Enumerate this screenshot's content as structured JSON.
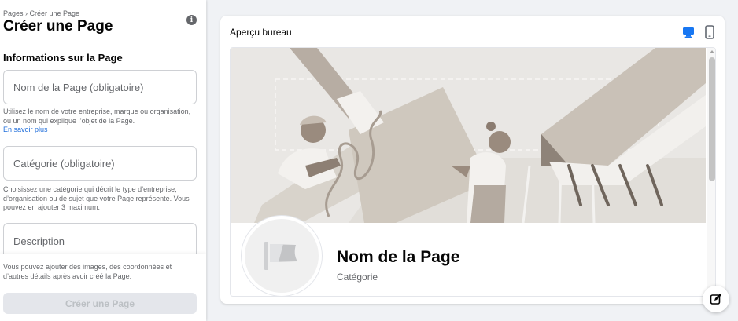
{
  "breadcrumb": "Pages › Créer une Page",
  "title": "Créer une Page",
  "info_icon": "i",
  "form": {
    "section_heading": "Informations sur la Page",
    "name_placeholder": "Nom de la Page (obligatoire)",
    "name_helper": "Utilisez le nom de votre entreprise, marque ou organisation, ou un nom qui explique l’objet de la Page.",
    "learn_more": "En savoir plus",
    "category_placeholder": "Catégorie (obligatoire)",
    "category_helper": "Choisissez une catégorie qui décrit le type d’entreprise, d’organisation ou de sujet que votre Page représente. Vous pouvez en ajouter 3 maximum.",
    "description_placeholder": "Description",
    "bottom_helper": "Vous pouvez ajouter des images, des coordonnées et d’autres détails après avoir créé la Page.",
    "create_button": "Créer une Page"
  },
  "preview": {
    "label": "Aperçu bureau",
    "page_name": "Nom de la Page",
    "category": "Catégorie"
  },
  "icons": {
    "desktop": "desktop-icon",
    "mobile": "mobile-icon",
    "info": "info-icon",
    "flag": "flag-icon",
    "edit": "edit-icon"
  },
  "colors": {
    "accent": "#1877f2",
    "link": "#216fdb",
    "disabled_button_bg": "#e4e6eb",
    "disabled_button_text": "#bcc0c4",
    "cover_bg": "#e9e7e4"
  }
}
